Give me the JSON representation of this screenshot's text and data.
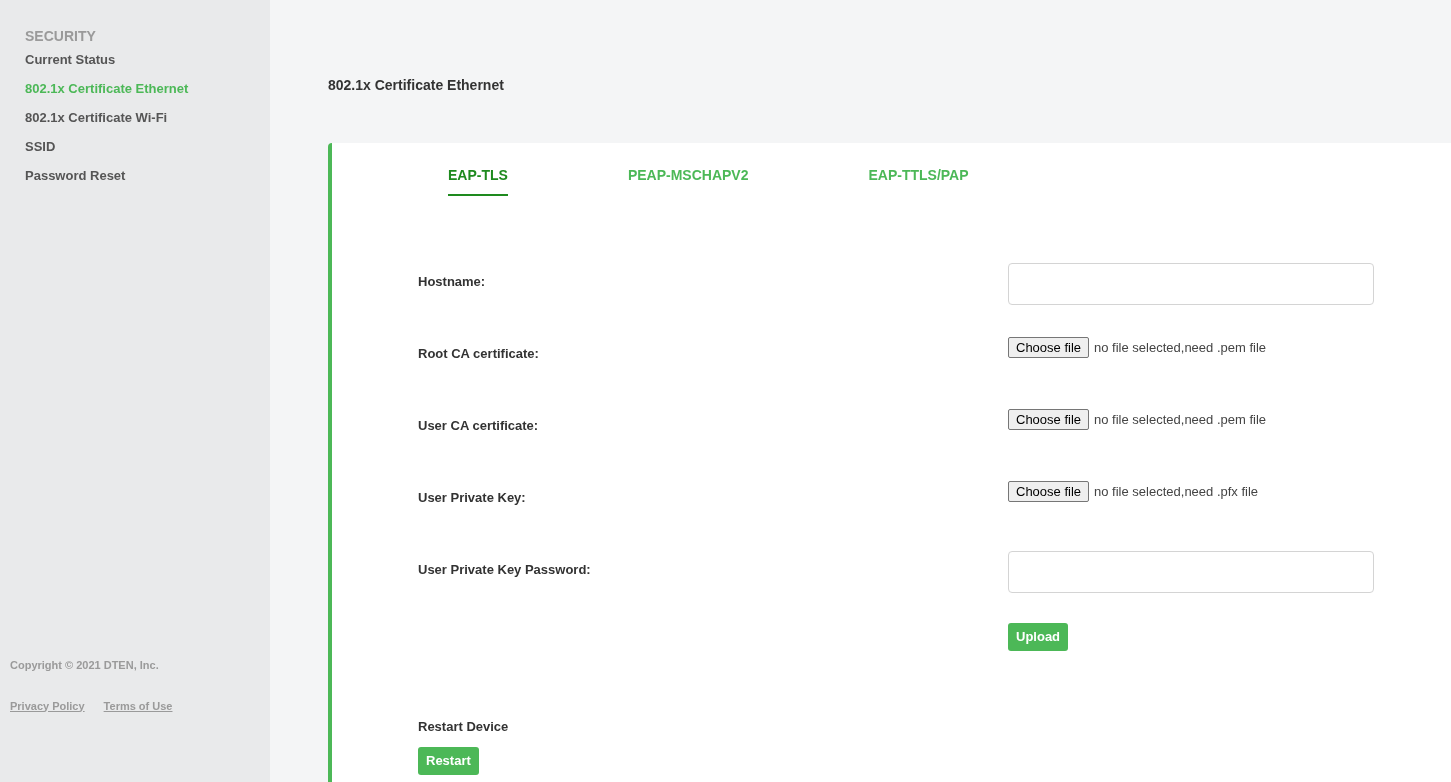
{
  "sidebar": {
    "section": "SECURITY",
    "items": [
      {
        "label": "Current Status",
        "selected": false
      },
      {
        "label": "802.1x Certificate Ethernet",
        "selected": true
      },
      {
        "label": "802.1x Certificate Wi-Fi",
        "selected": false
      },
      {
        "label": "SSID",
        "selected": false
      },
      {
        "label": "Password Reset",
        "selected": false
      }
    ],
    "copyright": "Copyright © 2021 DTEN, Inc.",
    "links": [
      "Privacy Policy",
      "Terms of Use"
    ]
  },
  "page_title": "802.1x Certificate Ethernet",
  "tabs": [
    {
      "label": "EAP-TLS",
      "selected": true
    },
    {
      "label": "PEAP-MSCHAPV2",
      "selected": false
    },
    {
      "label": "EAP-TTLS/PAP",
      "selected": false
    }
  ],
  "fields": [
    {
      "kind": "text",
      "label": "Hostname:"
    },
    {
      "kind": "file",
      "label": "Root CA certificate:",
      "button": "Choose file",
      "status": "no file selected,need .pem file"
    },
    {
      "kind": "file",
      "label": "User CA certificate:",
      "button": "Choose file",
      "status": "no file selected,need .pem file"
    },
    {
      "kind": "file",
      "label": "User Private Key:",
      "button": "Choose file",
      "status": "no file selected,need .pfx file"
    },
    {
      "kind": "text",
      "label": "User Private Key Password:"
    }
  ],
  "upload_button": "Upload",
  "restart": {
    "label": "Restart Device",
    "button": "Restart"
  }
}
